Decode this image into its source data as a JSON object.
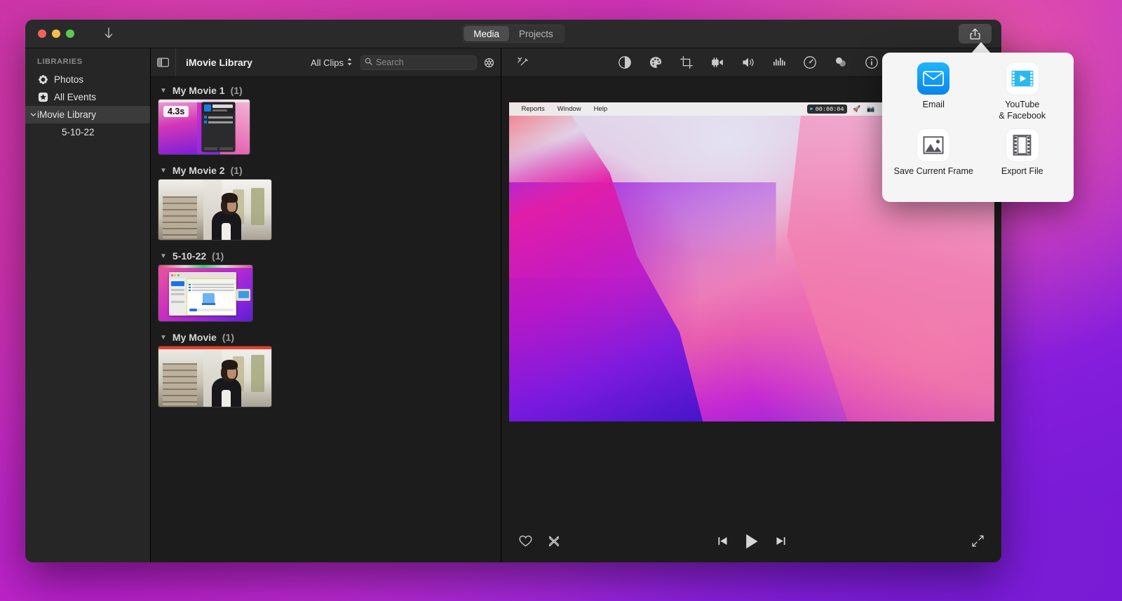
{
  "window": {
    "titlebar": {
      "download_icon": "download-arrow-icon",
      "share_icon": "share-icon",
      "segments": [
        {
          "label": "Media",
          "active": true
        },
        {
          "label": "Projects",
          "active": false
        }
      ]
    }
  },
  "sidebar": {
    "section_title": "LIBRARIES",
    "items": [
      {
        "label": "Photos",
        "icon": "photos-icon",
        "selected": false,
        "child": false,
        "twisty": ""
      },
      {
        "label": "All Events",
        "icon": "star-icon",
        "selected": false,
        "child": false,
        "twisty": ""
      },
      {
        "label": "iMovie Library",
        "icon": "",
        "selected": true,
        "child": false,
        "twisty": "chevron-down-icon"
      },
      {
        "label": "5-10-22",
        "icon": "",
        "selected": false,
        "child": true,
        "twisty": ""
      }
    ]
  },
  "browser": {
    "sidebar_toggle_icon": "sidebar-toggle-icon",
    "library_name": "iMovie Library",
    "filter_label": "All Clips",
    "filter_chevron": "updown-chevron-icon",
    "search": {
      "placeholder": "Search",
      "value": "",
      "icon": "search-icon"
    },
    "settings_icon": "gear-icon",
    "groups": [
      {
        "title": "My Movie 1",
        "count": "(1)",
        "thumb": "screen-recording-mac",
        "duration_badge": "4.3s",
        "used_in_project": false
      },
      {
        "title": "My Movie 2",
        "count": "(1)",
        "thumb": "man-in-room",
        "duration_badge": "",
        "used_in_project": false
      },
      {
        "title": "5-10-22",
        "count": "(1)",
        "thumb": "finder-archive-window",
        "duration_badge": "",
        "used_in_project": false
      },
      {
        "title": "My Movie",
        "count": "(1)",
        "thumb": "man-in-room",
        "duration_badge": "",
        "used_in_project": true
      }
    ]
  },
  "viewer": {
    "enhance_icon": "magic-wand-icon",
    "tools": [
      {
        "name": "color-balance-icon"
      },
      {
        "name": "color-correction-icon"
      },
      {
        "name": "crop-icon"
      },
      {
        "name": "stabilization-icon"
      },
      {
        "name": "volume-icon"
      },
      {
        "name": "noise-reduction-icon"
      },
      {
        "name": "speed-icon"
      },
      {
        "name": "filters-icon"
      },
      {
        "name": "info-icon"
      }
    ],
    "preview": {
      "menu_items": [
        "Reports",
        "Window",
        "Help"
      ],
      "timer": "00:00:04",
      "status_icons": [
        "rocket-icon",
        "screenshot-icon",
        "dropbox-icon",
        "spinner-icon",
        "bluetooth-transfer-icon",
        "battery-icon",
        "network-icon",
        "display-icon",
        "bluetooth-icon",
        "control-center-icon"
      ]
    },
    "transport": {
      "favorite_icon": "heart-icon",
      "reject_icon": "reject-x-icon",
      "prev_icon": "skip-back-icon",
      "play_icon": "play-icon",
      "next_icon": "skip-forward-icon",
      "fullscreen_icon": "expand-icon"
    }
  },
  "share_popover": {
    "items": [
      {
        "label": "Email",
        "icon": "email-icon",
        "style": "email"
      },
      {
        "label": "YouTube\n& Facebook",
        "line1": "YouTube",
        "line2": "& Facebook",
        "icon": "youtube-facebook-icon",
        "style": "white"
      },
      {
        "label": "Save Current Frame",
        "icon": "save-frame-icon",
        "style": "white"
      },
      {
        "label": "Export File",
        "icon": "export-file-icon",
        "style": "white"
      }
    ]
  },
  "colors": {
    "accent_blue": "#0a84ea",
    "used_clip_red": "#f03c26",
    "selection_gray": "#3b3b3b"
  }
}
